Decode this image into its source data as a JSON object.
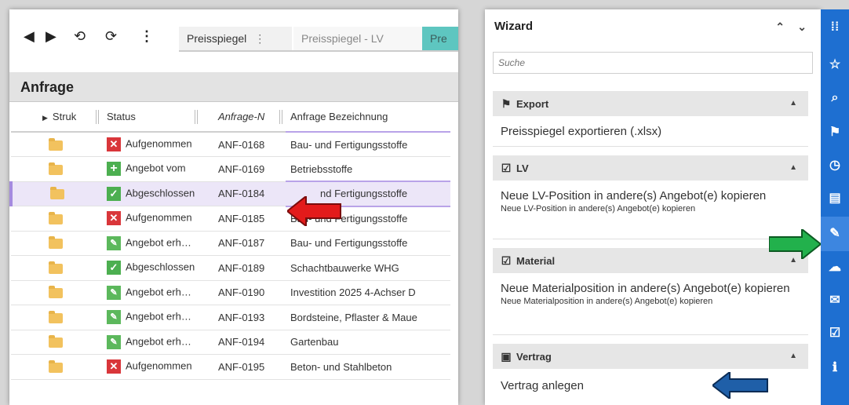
{
  "toolbar": {
    "tabs": [
      "Preisspiegel",
      "Preisspiegel - LV",
      "Pre"
    ],
    "tab_menu": "⋮"
  },
  "anfrage": {
    "title": "Anfrage",
    "columns": [
      "Struk",
      "Status",
      "Anfrage-N",
      "Anfrage Bezeichnung"
    ],
    "rows": [
      {
        "status": "Aufgenommen",
        "status_icon": "x-icon",
        "nr": "ANF-0168",
        "bez": "Bau- und Fertigungsstoffe"
      },
      {
        "status": "Angebot vom",
        "status_icon": "plus-icon",
        "nr": "ANF-0169",
        "bez": "Betriebsstoffe"
      },
      {
        "status": "Abgeschlossen",
        "status_icon": "check-icon",
        "nr": "ANF-0184",
        "bez": "nd Fertigungsstoffe"
      },
      {
        "status": "Aufgenommen",
        "status_icon": "x-icon",
        "nr": "ANF-0185",
        "bez": "Bau- und Fertigungsstoffe"
      },
      {
        "status": "Angebot erh…",
        "status_icon": "edit-icon",
        "nr": "ANF-0187",
        "bez": "Bau- und Fertigungsstoffe"
      },
      {
        "status": "Abgeschlossen",
        "status_icon": "check-icon",
        "nr": "ANF-0189",
        "bez": "Schachtbauwerke WHG"
      },
      {
        "status": "Angebot erh…",
        "status_icon": "edit-icon",
        "nr": "ANF-0190",
        "bez": "Investition 2025 4-Achser D"
      },
      {
        "status": "Angebot erh…",
        "status_icon": "edit-icon",
        "nr": "ANF-0193",
        "bez": "Bordsteine, Pflaster & Maue"
      },
      {
        "status": "Angebot erh…",
        "status_icon": "edit-icon",
        "nr": "ANF-0194",
        "bez": "Gartenbau"
      },
      {
        "status": "Aufgenommen",
        "status_icon": "x-icon",
        "nr": "ANF-0195",
        "bez": "Beton- und Stahlbeton"
      }
    ],
    "selected_row": 2
  },
  "wizard": {
    "title": "Wizard",
    "search_placeholder": "Suche",
    "sections": [
      {
        "title": "Export",
        "icon": "flag-icon",
        "items": [
          {
            "label": "Preisspiegel exportieren (.xlsx)",
            "sub": ""
          }
        ]
      },
      {
        "title": "LV",
        "icon": "checkbox-icon",
        "items": [
          {
            "label": "Neue LV-Position in andere(s) Angebot(e) kopieren",
            "sub": "Neue LV-Position in andere(s) Angebot(e) kopieren"
          }
        ]
      },
      {
        "title": "Material",
        "icon": "checkbox-icon",
        "items": [
          {
            "label": "Neue Materialposition in andere(s) Angebot(e) kopieren",
            "sub": "Neue Materialposition in andere(s) Angebot(e) kopieren"
          }
        ]
      },
      {
        "title": "Vertrag",
        "icon": "contract-icon",
        "items": [
          {
            "label": "Vertrag anlegen",
            "sub": ""
          }
        ]
      }
    ]
  },
  "colors": {
    "accent_blue": "#1e6fd1",
    "arrow_red": "#e31b1b",
    "arrow_green": "#22b14c",
    "arrow_blue": "#1f5fa8",
    "selection": "#ece6f8"
  },
  "iconbar": [
    "apps-icon",
    "favorite-icon",
    "search-icon",
    "flag-icon",
    "history-icon",
    "document-icon",
    "wizard-icon",
    "cloud-icon",
    "mail-icon",
    "tasks-icon",
    "info-icon"
  ]
}
